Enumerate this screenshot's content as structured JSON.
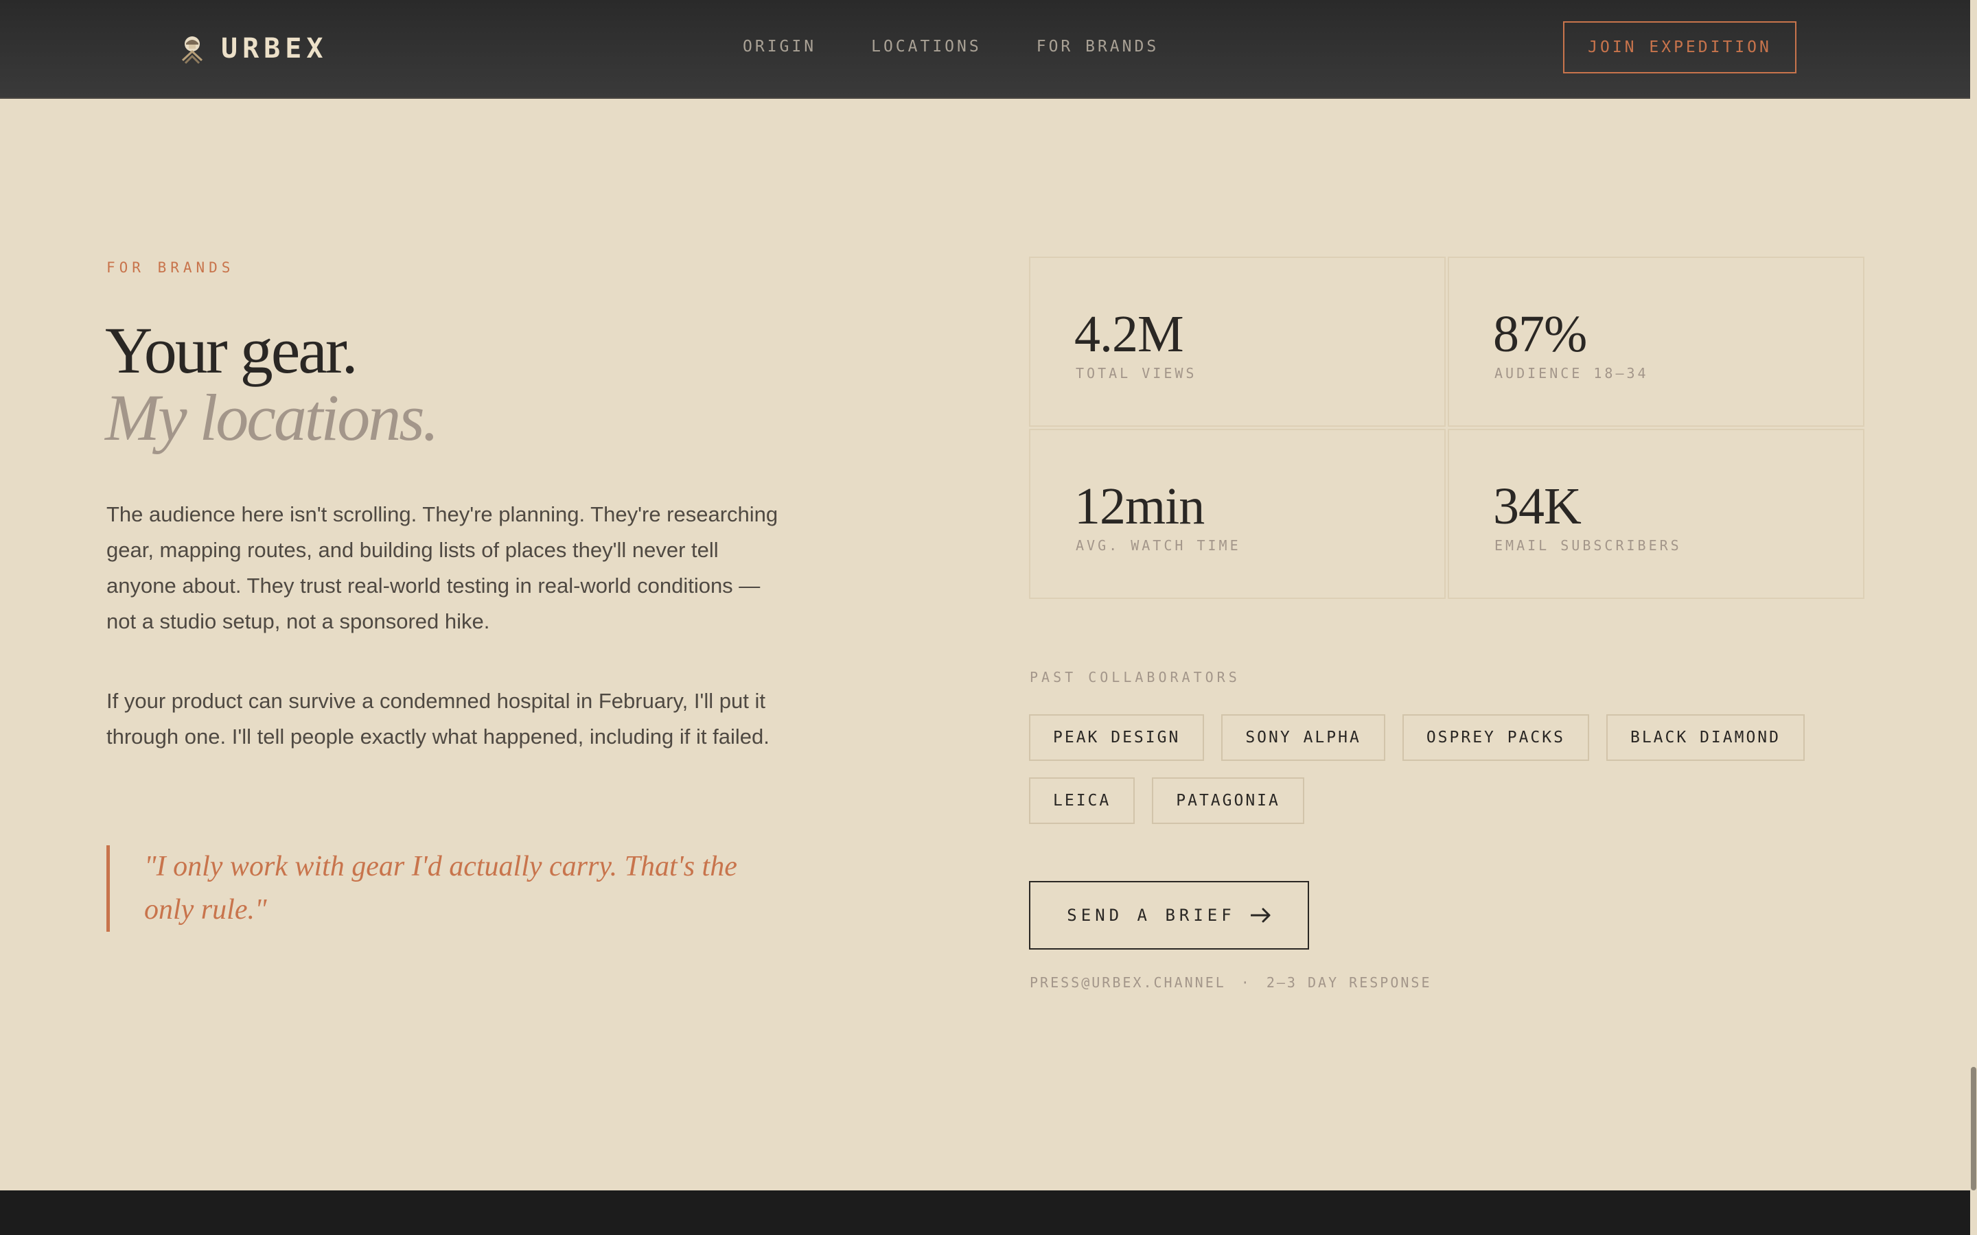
{
  "nav": {
    "brand": "URBEX",
    "links": [
      "ORIGIN",
      "LOCATIONS",
      "FOR BRANDS"
    ],
    "cta": "JOIN EXPEDITION"
  },
  "hero": {
    "eyebrow": "FOR BRANDS",
    "headline_line1": "Your gear.",
    "headline_line2": "My locations.",
    "paragraph1": "The audience here isn't scrolling. They're planning. They're researching gear, mapping routes, and building lists of places they'll never tell anyone about. They trust real-world testing in real-world conditions — not a studio setup, not a sponsored hike.",
    "paragraph2": "If your product can survive a condemned hospital in February, I'll put it through one. I'll tell people exactly what happened, including if it failed.",
    "quote": "\"I only work with gear I'd actually carry. That's the only rule.\""
  },
  "stats": [
    {
      "value": "4.2M",
      "label": "TOTAL VIEWS"
    },
    {
      "value": "87%",
      "label": "AUDIENCE 18–34"
    },
    {
      "value": "12min",
      "label": "AVG. WATCH TIME"
    },
    {
      "value": "34K",
      "label": "EMAIL SUBSCRIBERS"
    }
  ],
  "collaborators": {
    "title": "PAST COLLABORATORS",
    "tags": [
      "PEAK DESIGN",
      "SONY ALPHA",
      "OSPREY PACKS",
      "BLACK DIAMOND",
      "LEICA",
      "PATAGONIA"
    ]
  },
  "send_brief": {
    "label": "SEND A BRIEF",
    "icon": "arrow-right-icon"
  },
  "contact": {
    "email": "PRESS@URBEX.CHANNEL",
    "separator": "·",
    "response": "2–3 DAY RESPONSE"
  },
  "colors": {
    "background": "#e7dcc6",
    "accent": "#c8744c",
    "nav_background": "#2f2f2f",
    "text_dark": "#2a2724",
    "text_muted": "#a3968a"
  }
}
